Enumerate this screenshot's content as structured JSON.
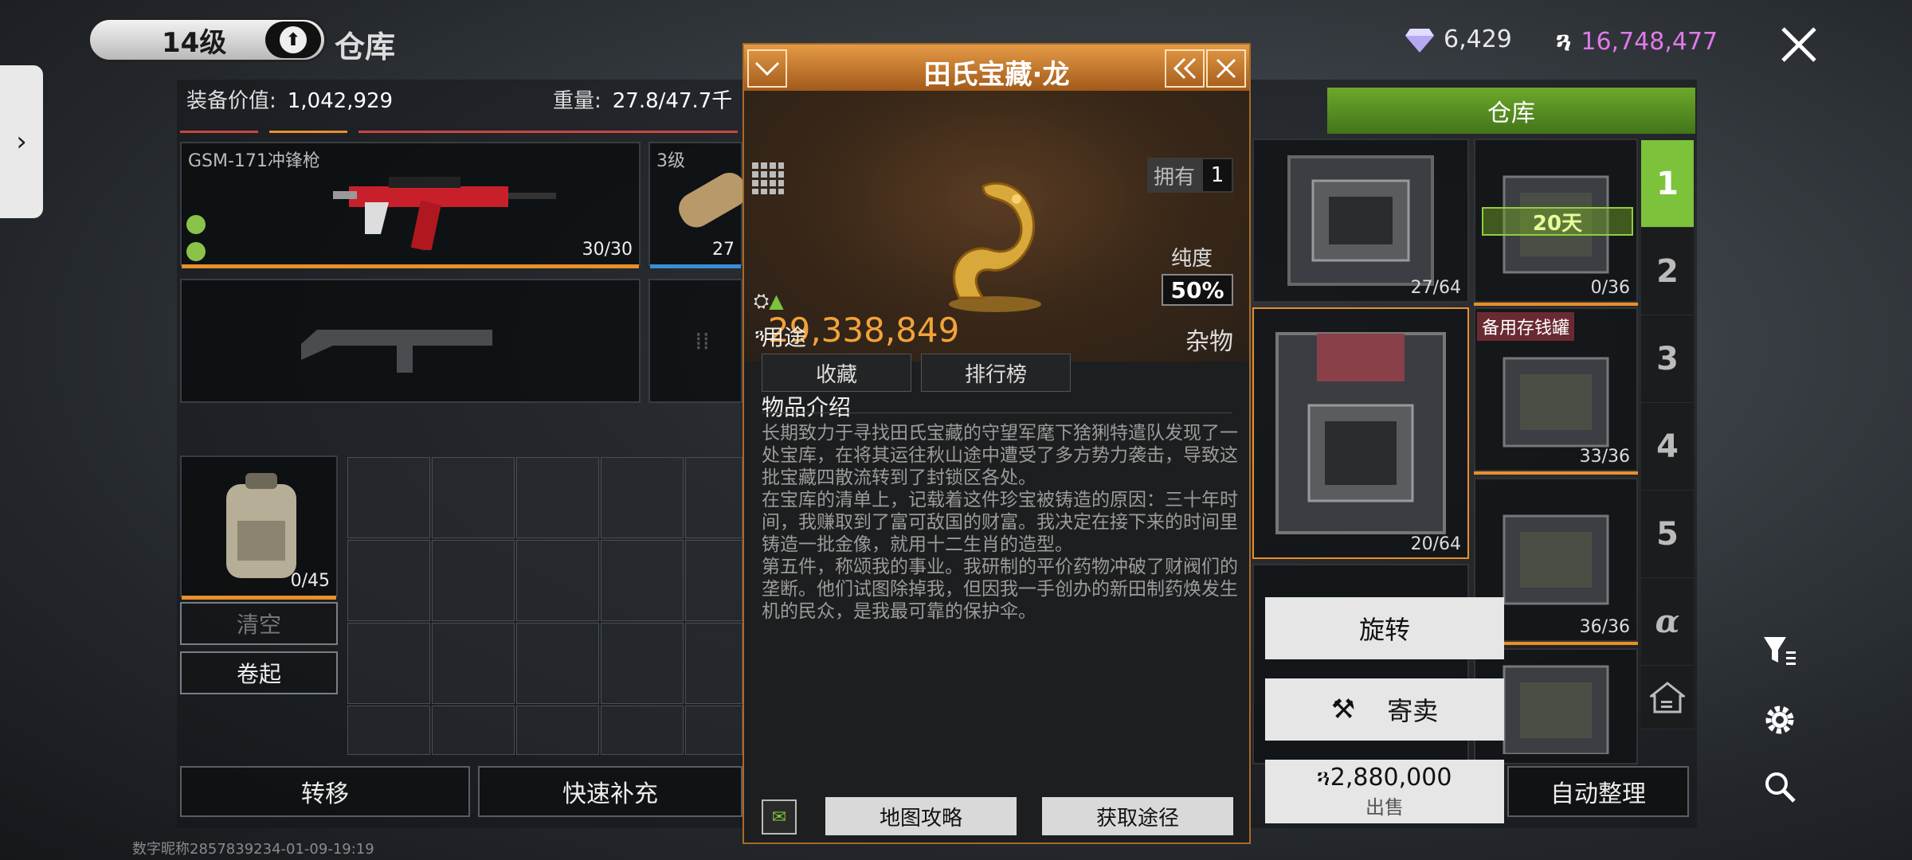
{
  "header": {
    "level": "14级",
    "page_title": "仓库",
    "gems": "6,429",
    "coins": "16,748,477",
    "colors": {
      "coins": "#e07ae8",
      "accent_green": "#7cc23a",
      "orange": "#e8902a"
    }
  },
  "loadout": {
    "value_label": "装备价值:",
    "value": "1,042,929",
    "weight_label": "重量:",
    "weight": "27.8/47.7千",
    "primary": {
      "name": "GSM-171冲锋枪",
      "count": "30/30"
    },
    "ammo": {
      "level": "3级",
      "count": "27"
    },
    "backpack_count": "0/45",
    "clear_label": "清空",
    "roll_label": "卷起",
    "transfer_label": "转移",
    "refill_label": "快速补充"
  },
  "item": {
    "title": "田氏宝藏·龙",
    "own_label": "拥有",
    "own_count": "1",
    "purity_label": "纯度",
    "purity": "50%",
    "price": "29,338,849",
    "category": "杂物",
    "usage_label": "用途",
    "tags": [
      "收藏",
      "排行榜"
    ],
    "intro_label": "物品介绍",
    "description": [
      "长期致力于寻找田氏宝藏的守望军麾下猞猁特遣队发现了一处宝库，在将其运往秋山途中遭受了多方势力袭击，导致这批宝藏四散流转到了封锁区各处。",
      "在宝库的清单上，记载着这件珍宝被铸造的原因：三十年时间，我赚取到了富可敌国的财富。我决定在接下来的时间里铸造一批金像，就用十二生肖的造型。",
      "第五件，称颂我的事业。我研制的平价药物冲破了财阀们的垄断。他们试图除掉我，但因我一手创办的新田制药焕发生机的民众，是我最可靠的保护伞。"
    ],
    "map_guide_label": "地图攻略",
    "acquire_label": "获取途径"
  },
  "warehouse": {
    "tab_label": "仓库",
    "boxes": [
      {
        "count": "27/64"
      },
      {
        "count": "0/36",
        "timer": "20天"
      },
      {
        "count": "20/64"
      },
      {
        "count": "33/36",
        "tag": "备用存钱罐"
      },
      {
        "count": "36/36"
      },
      {
        "count": ""
      }
    ],
    "pages": [
      "1",
      "2",
      "3",
      "4",
      "5",
      "α"
    ],
    "auto_sort_label": "自动整理"
  },
  "context_menu": {
    "rotate_label": "旋转",
    "consign_label": "寄卖",
    "sell_price": "2,880,000",
    "sell_label": "出售"
  },
  "watermark": "数字昵称2857839234-01-09-19:19"
}
